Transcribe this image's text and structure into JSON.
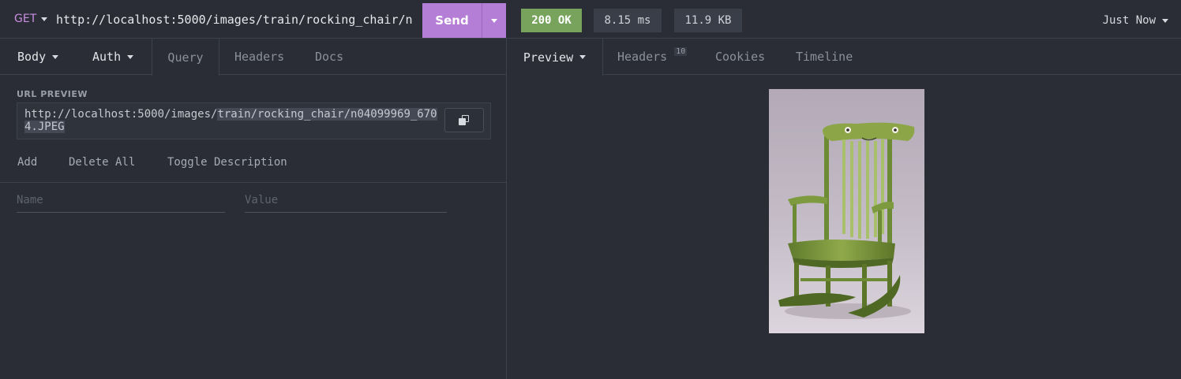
{
  "request": {
    "method": "GET",
    "url": "http://localhost:5000/images/train/rocking_chair/n04099969_6704.JPEG",
    "send_label": "Send"
  },
  "response": {
    "status": "200 OK",
    "time": "8.15 ms",
    "size": "11.9 KB",
    "history_label": "Just Now"
  },
  "left_tabs": {
    "body": "Body",
    "auth": "Auth",
    "query": "Query",
    "headers": "Headers",
    "docs": "Docs"
  },
  "url_preview": {
    "label": "URL PREVIEW",
    "base": "http://localhost:5000/images/",
    "highlighted": "train/rocking_chair/n04099969_6704.JPEG"
  },
  "params": {
    "add": "Add",
    "delete_all": "Delete All",
    "toggle_description": "Toggle Description",
    "name_placeholder": "Name",
    "value_placeholder": "Value"
  },
  "right_tabs": {
    "preview": "Preview",
    "headers": "Headers",
    "headers_count": "10",
    "cookies": "Cookies",
    "timeline": "Timeline"
  },
  "colors": {
    "accent": "#b57ed6",
    "status_ok": "#77a35d",
    "background": "#2a2d36"
  }
}
